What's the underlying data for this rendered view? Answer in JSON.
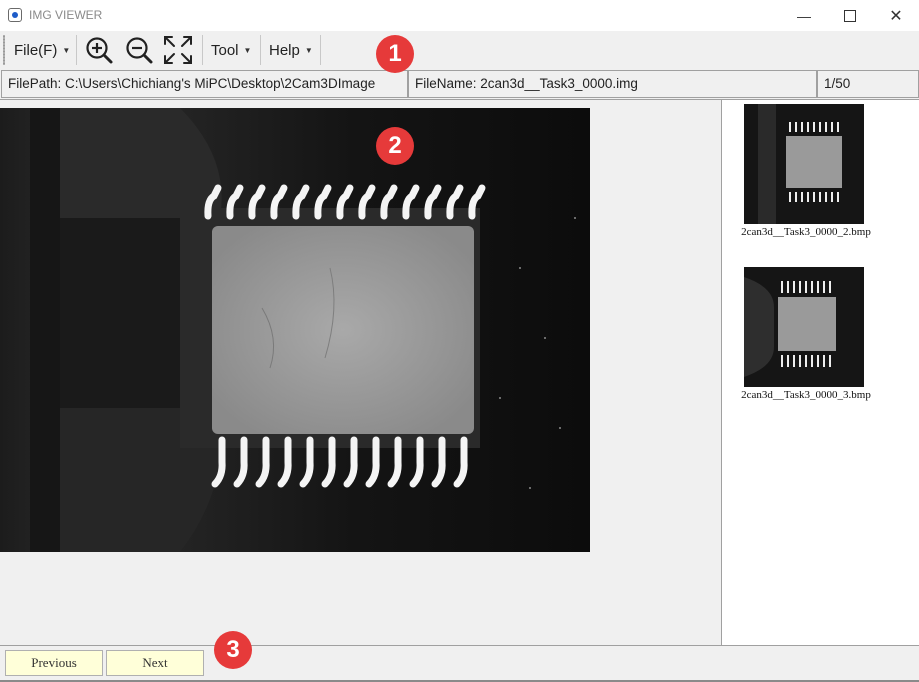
{
  "window": {
    "title": "IMG VIEWER",
    "minimize_icon": "minimize-icon",
    "maximize_icon": "maximize-icon",
    "close_icon": "close-icon"
  },
  "toolbar": {
    "file_label": "File(F)",
    "zoom_in_icon": "zoom-in-icon",
    "zoom_out_icon": "zoom-out-icon",
    "fit_icon": "fit-to-window-icon",
    "tool_label": "Tool",
    "help_label": "Help"
  },
  "status": {
    "filepath": "FilePath: C:\\Users\\Chichiang's MiPC\\Desktop\\2Cam3DImage",
    "filename": "FileName: 2can3d__Task3_0000.img",
    "page": "1/50"
  },
  "thumbnails": [
    {
      "caption": "2can3d__Task3_0000_2.bmp"
    },
    {
      "caption": "2can3d__Task3_0000_3.bmp"
    }
  ],
  "navigation": {
    "previous_label": "Previous",
    "next_label": "Next"
  },
  "annotations": [
    "1",
    "2",
    "3"
  ],
  "colors": {
    "badge": "#e63a3a",
    "nav_button_bg": "#ffffd9"
  }
}
